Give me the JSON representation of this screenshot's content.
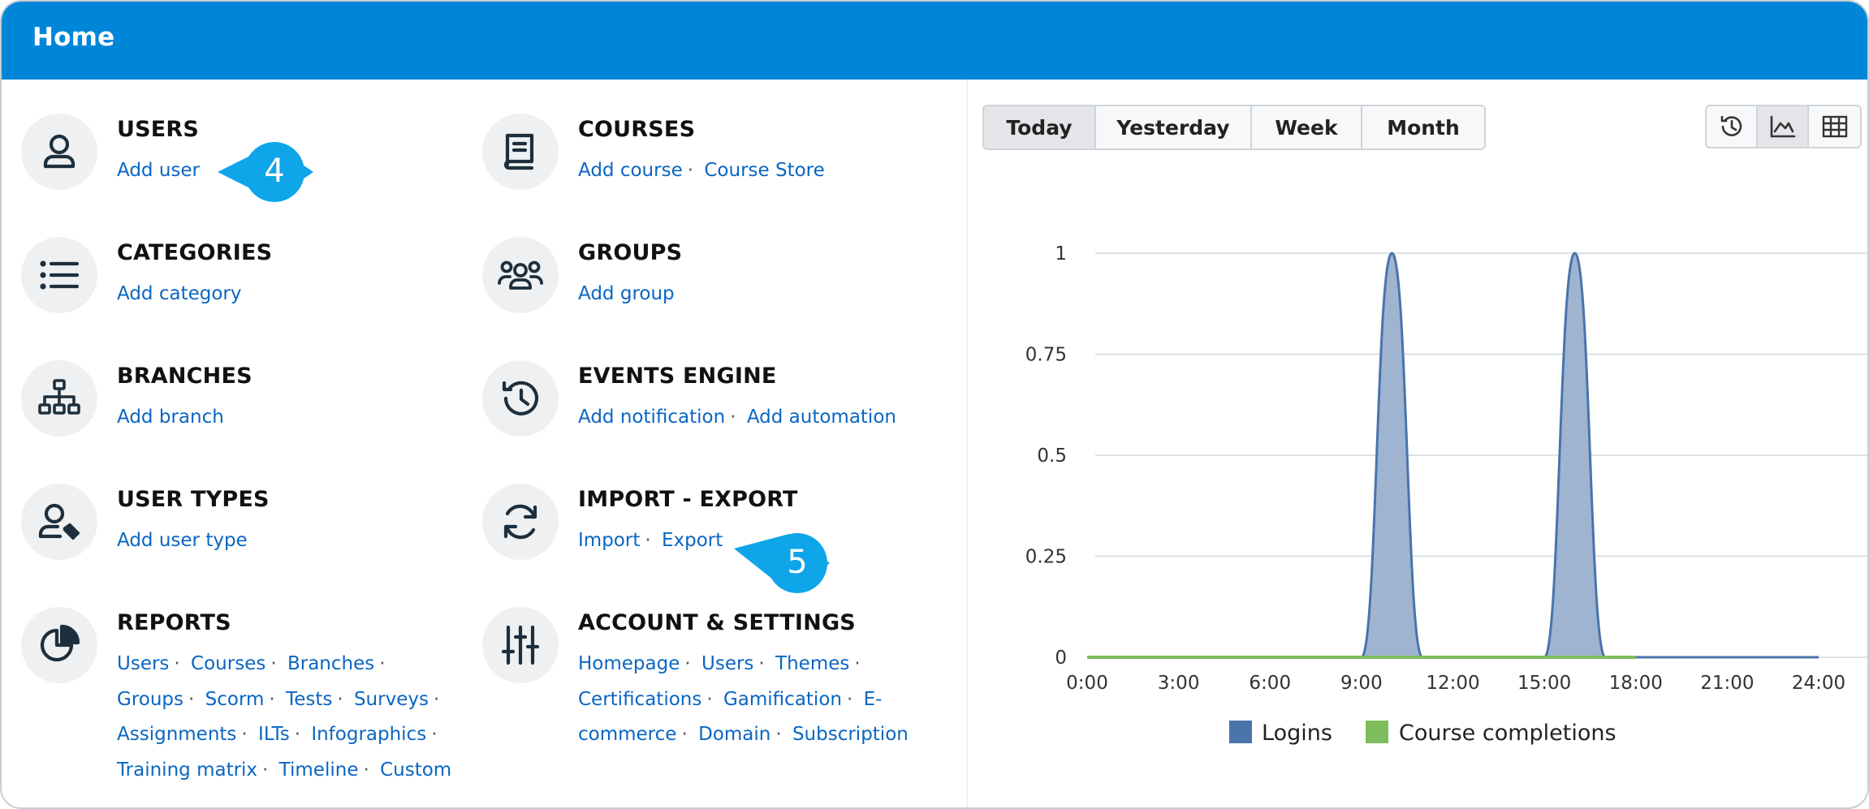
{
  "header": {
    "title": "Home"
  },
  "tiles": [
    {
      "title": "USERS",
      "links": [
        "Add user"
      ]
    },
    {
      "title": "CATEGORIES",
      "links": [
        "Add category"
      ]
    },
    {
      "title": "BRANCHES",
      "links": [
        "Add branch"
      ]
    },
    {
      "title": "USER TYPES",
      "links": [
        "Add user type"
      ]
    },
    {
      "title": "REPORTS",
      "links": [
        "Users",
        "Courses",
        "Branches",
        "Groups",
        "Scorm",
        "Tests",
        "Surveys",
        "Assignments",
        "ILTs",
        "Infographics",
        "Training matrix",
        "Timeline",
        "Custom"
      ]
    },
    {
      "title": "COURSES",
      "links": [
        "Add course",
        "Course Store"
      ]
    },
    {
      "title": "GROUPS",
      "links": [
        "Add group"
      ]
    },
    {
      "title": "EVENTS ENGINE",
      "links": [
        "Add notification",
        "Add automation"
      ]
    },
    {
      "title": "IMPORT - EXPORT",
      "links": [
        "Import",
        "Export"
      ]
    },
    {
      "title": "ACCOUNT & SETTINGS",
      "links": [
        "Homepage",
        "Users",
        "Themes",
        "Certifications",
        "Gamification",
        "E-commerce",
        "Domain",
        "Subscription"
      ]
    }
  ],
  "callouts": {
    "first": "4",
    "second": "5"
  },
  "range_tabs": [
    "Today",
    "Yesterday",
    "Week",
    "Month"
  ],
  "range_active": "Today",
  "view_buttons": {
    "items": [
      "history-icon",
      "area-chart-icon",
      "table-icon"
    ],
    "active": "area-chart-icon"
  },
  "chart_data": {
    "type": "area",
    "x_ticks": [
      "0:00",
      "3:00",
      "6:00",
      "9:00",
      "12:00",
      "15:00",
      "18:00",
      "21:00",
      "24:00"
    ],
    "y_ticks": [
      "0",
      "0.25",
      "0.5",
      "0.75",
      "1"
    ],
    "ylim": [
      0,
      1
    ],
    "xlim_hours": [
      0,
      24
    ],
    "series": [
      {
        "name": "Logins",
        "color": "#4a74aa",
        "fill": "#9fb4d1",
        "points": [
          [
            0,
            0
          ],
          [
            9,
            0
          ],
          [
            10,
            1
          ],
          [
            11,
            0
          ],
          [
            15,
            0
          ],
          [
            16,
            1
          ],
          [
            17,
            0
          ],
          [
            24,
            0
          ]
        ]
      },
      {
        "name": "Course completions",
        "color": "#7dbd5c",
        "points": [
          [
            0,
            0
          ],
          [
            18,
            0
          ]
        ]
      }
    ],
    "legend": "bottom"
  }
}
